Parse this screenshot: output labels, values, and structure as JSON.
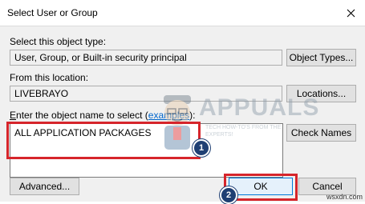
{
  "window": {
    "title": "Select User or Group"
  },
  "object_type": {
    "label": "Select this object type:",
    "value": "User, Group, or Built-in security principal",
    "button": "Object Types..."
  },
  "location": {
    "label": "From this location:",
    "value": "LIVEBRAYO",
    "button": "Locations..."
  },
  "names": {
    "label_pre": "E",
    "label_rest": "nter the object name to select (",
    "label_link": "examples",
    "label_close": "):",
    "value": "ALL APPLICATION PACKAGES",
    "check_button": "Check Names"
  },
  "footer": {
    "advanced": "Advanced...",
    "ok": "OK",
    "cancel": "Cancel"
  },
  "annotations": {
    "step1": "1",
    "step2": "2"
  },
  "watermark": {
    "brand": "APPUALS",
    "tagline": "TECH HOW-TO'S FROM THE EXPERTS!"
  },
  "site": "wsxdn.com",
  "colors": {
    "highlight": "#d6252b",
    "badge": "#1f3f73",
    "link": "#0066cc"
  }
}
